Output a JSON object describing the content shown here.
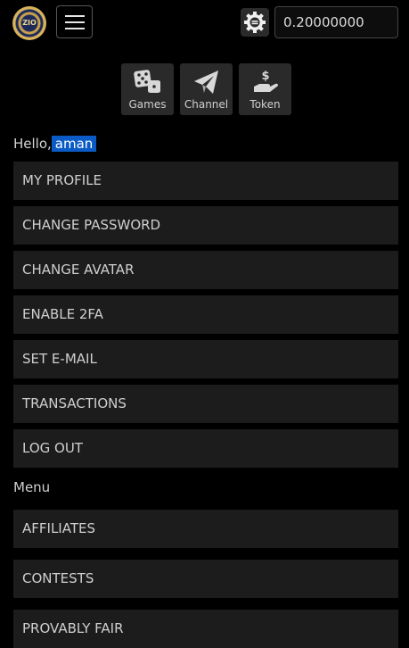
{
  "header": {
    "logo_text": "ZIO",
    "menu_toggle_icon": "hamburger-icon",
    "settings_icon": "gear-icon",
    "balance": "0.20000000"
  },
  "quick_links": [
    {
      "label": "Games",
      "icon": "dice-icon"
    },
    {
      "label": "Channel",
      "icon": "paper-plane-icon"
    },
    {
      "label": "Token",
      "icon": "hand-dollar-icon"
    }
  ],
  "greeting": {
    "prefix": "Hello,",
    "username": "aman"
  },
  "account_menu": [
    {
      "label": "MY PROFILE"
    },
    {
      "label": "CHANGE PASSWORD"
    },
    {
      "label": "CHANGE AVATAR"
    },
    {
      "label": "ENABLE 2FA"
    },
    {
      "label": "SET E-MAIL"
    },
    {
      "label": "TRANSACTIONS"
    },
    {
      "label": "LOG OUT"
    }
  ],
  "menu_section": {
    "title": "Menu",
    "items": [
      {
        "label": "AFFILIATES"
      },
      {
        "label": "CONTESTS"
      },
      {
        "label": "PROVABLY FAIR"
      }
    ]
  },
  "colors": {
    "background": "#000000",
    "item_bg": "#1c1c1c",
    "selection": "#0a5bc5"
  }
}
